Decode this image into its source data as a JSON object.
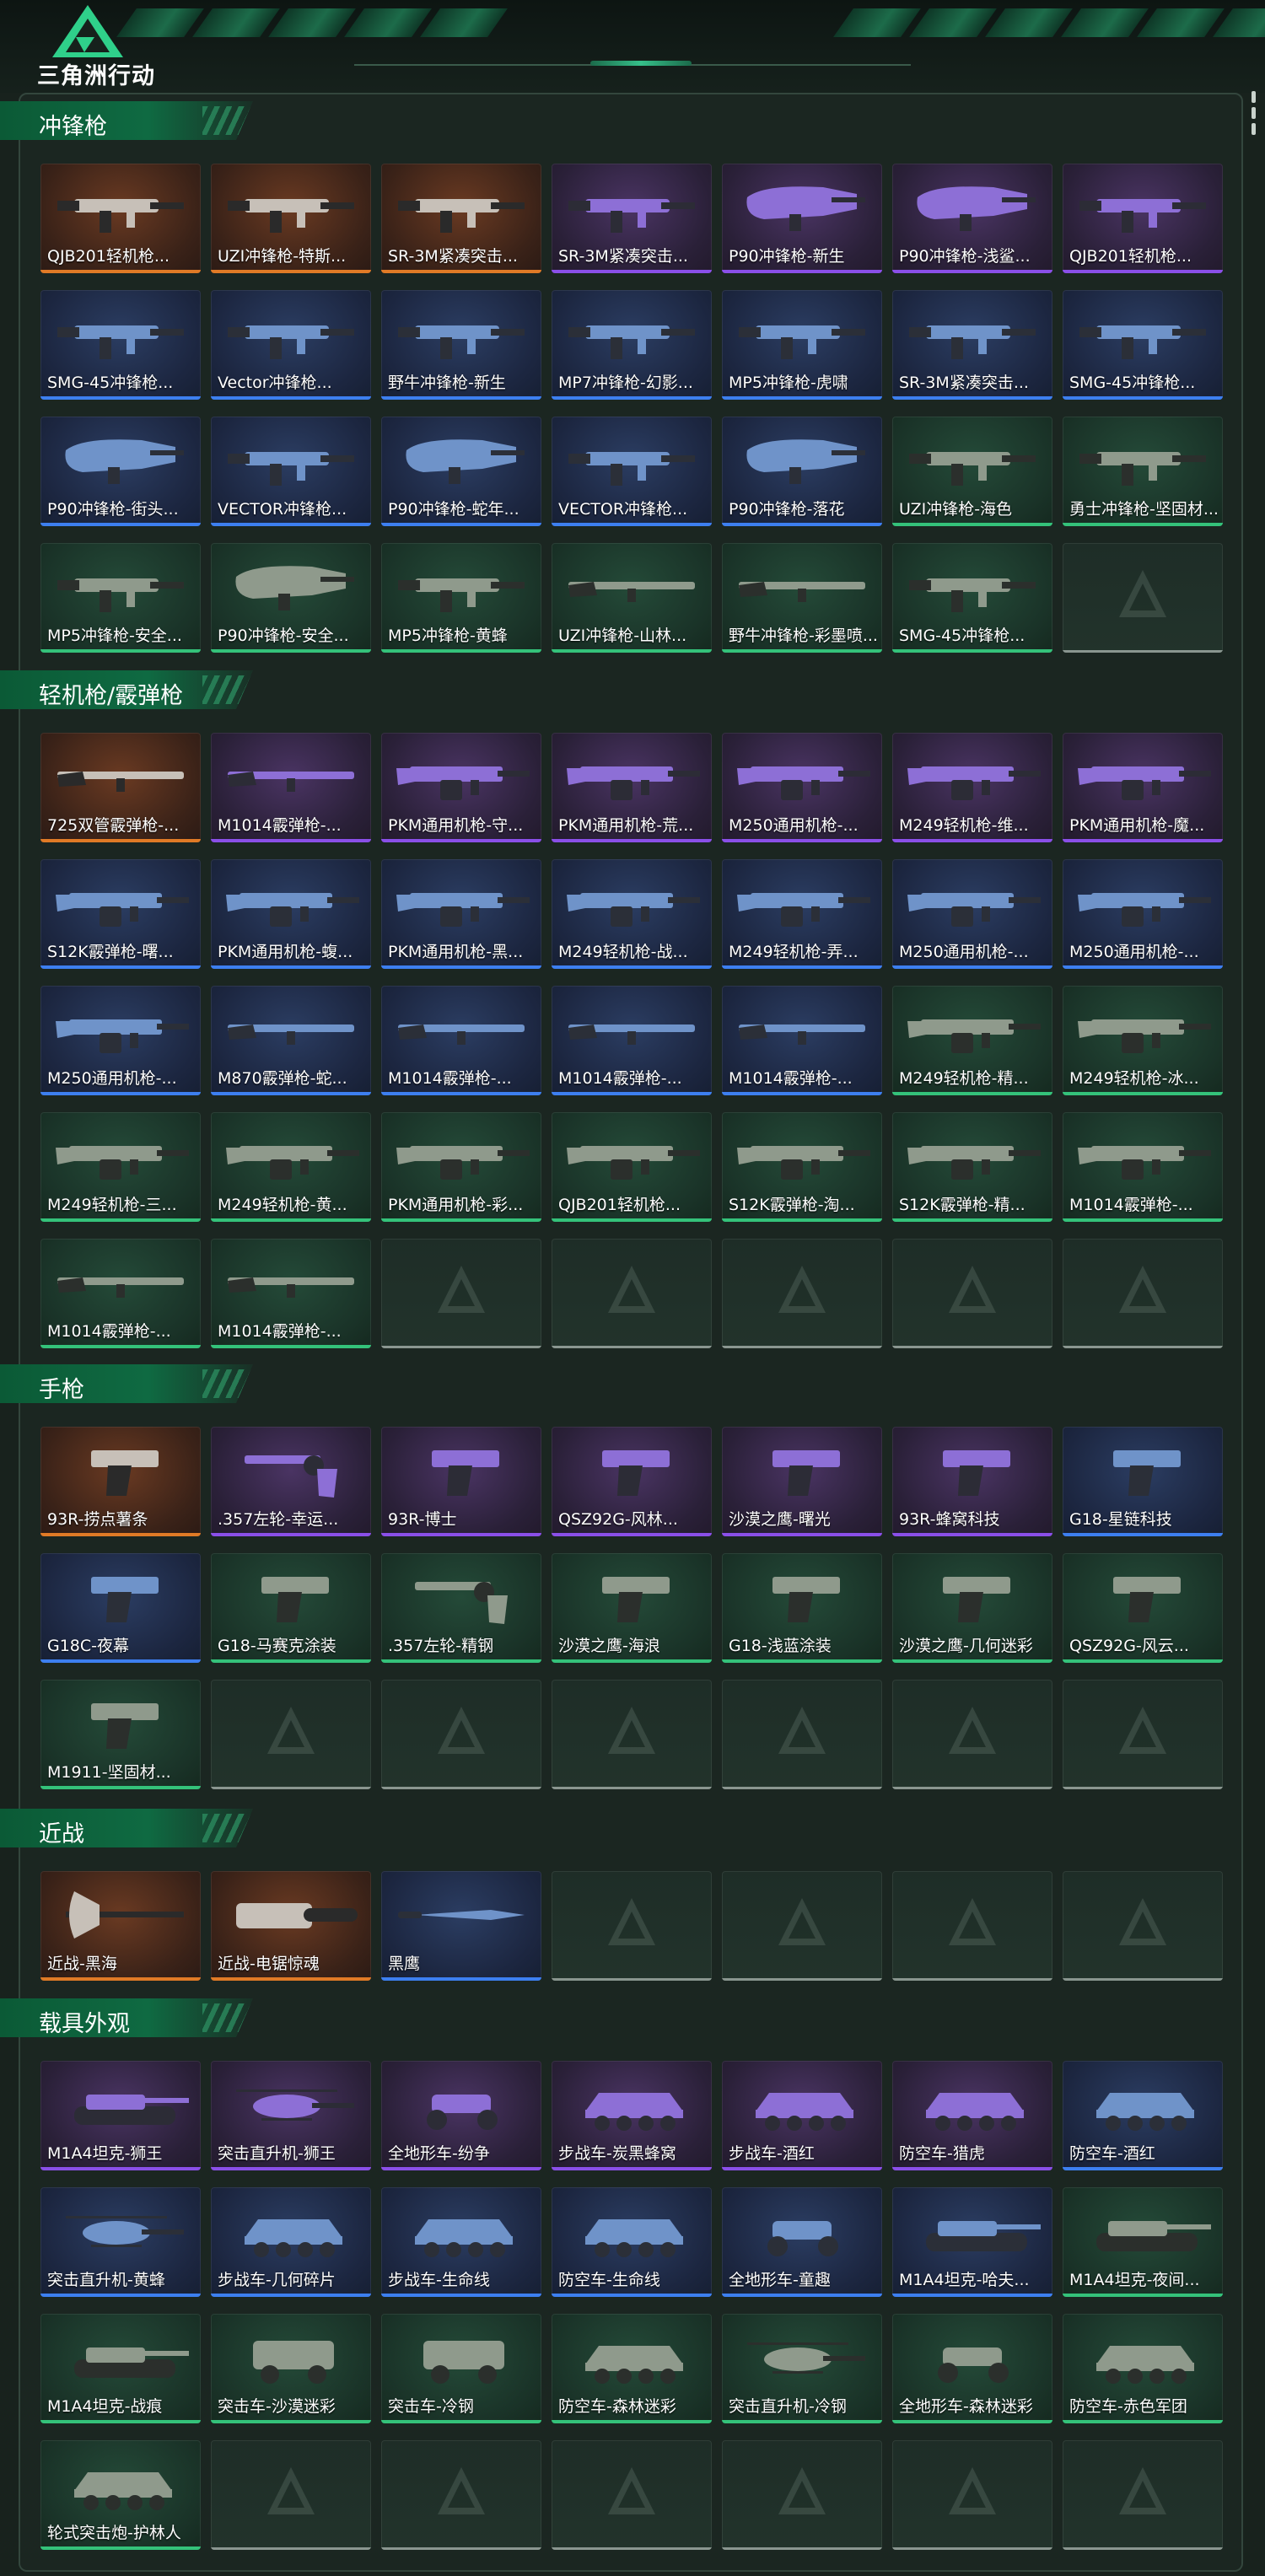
{
  "header": {
    "logo_text": "三角洲行动"
  },
  "colors": {
    "orange": "#e07a26",
    "purple": "#8a4fe8",
    "blue": "#3d7ff0",
    "green": "#34c27a"
  },
  "sections": [
    {
      "title": "冲锋枪",
      "items": [
        {
          "label": "QJB201轻机枪...",
          "rarity": "orange",
          "art": "smg"
        },
        {
          "label": "UZI冲锋枪-特斯...",
          "rarity": "orange",
          "art": "smg"
        },
        {
          "label": "SR-3M紧凑突击...",
          "rarity": "orange",
          "art": "smg"
        },
        {
          "label": "SR-3M紧凑突击...",
          "rarity": "purple",
          "art": "smg"
        },
        {
          "label": "P90冲锋枪-新生",
          "rarity": "purple",
          "art": "p90"
        },
        {
          "label": "P90冲锋枪-浅鲨...",
          "rarity": "purple",
          "art": "p90"
        },
        {
          "label": "QJB201轻机枪...",
          "rarity": "purple",
          "art": "smg"
        },
        {
          "label": "SMG-45冲锋枪...",
          "rarity": "blue",
          "art": "smg"
        },
        {
          "label": "Vector冲锋枪...",
          "rarity": "blue",
          "art": "smg"
        },
        {
          "label": "野牛冲锋枪-新生",
          "rarity": "blue",
          "art": "smg"
        },
        {
          "label": "MP7冲锋枪-幻影...",
          "rarity": "blue",
          "art": "smg"
        },
        {
          "label": "MP5冲锋枪-虎啸",
          "rarity": "blue",
          "art": "smg"
        },
        {
          "label": "SR-3M紧凑突击...",
          "rarity": "blue",
          "art": "smg"
        },
        {
          "label": "SMG-45冲锋枪...",
          "rarity": "blue",
          "art": "smg"
        },
        {
          "label": "P90冲锋枪-街头...",
          "rarity": "blue",
          "art": "p90"
        },
        {
          "label": "VECTOR冲锋枪...",
          "rarity": "blue",
          "art": "smg"
        },
        {
          "label": "P90冲锋枪-蛇年...",
          "rarity": "blue",
          "art": "p90"
        },
        {
          "label": "VECTOR冲锋枪...",
          "rarity": "blue",
          "art": "smg"
        },
        {
          "label": "P90冲锋枪-落花",
          "rarity": "blue",
          "art": "p90"
        },
        {
          "label": "UZI冲锋枪-海色",
          "rarity": "green",
          "art": "smg"
        },
        {
          "label": "勇士冲锋枪-坚固材...",
          "rarity": "green",
          "art": "smg"
        },
        {
          "label": "MP5冲锋枪-安全...",
          "rarity": "green",
          "art": "smg"
        },
        {
          "label": "P90冲锋枪-安全...",
          "rarity": "green",
          "art": "p90"
        },
        {
          "label": "MP5冲锋枪-黄蜂",
          "rarity": "green",
          "art": "smg"
        },
        {
          "label": "UZI冲锋枪-山林...",
          "rarity": "green",
          "art": "rifle"
        },
        {
          "label": "野牛冲锋枪-彩墨喷...",
          "rarity": "green",
          "art": "rifle"
        },
        {
          "label": "SMG-45冲锋枪...",
          "rarity": "green",
          "art": "smg"
        }
      ],
      "empty": 1
    },
    {
      "title": "轻机枪/霰弹枪",
      "items": [
        {
          "label": "725双管霰弹枪-...",
          "rarity": "orange",
          "art": "rifle"
        },
        {
          "label": "M1014霰弹枪-...",
          "rarity": "purple",
          "art": "rifle"
        },
        {
          "label": "PKM通用机枪-守...",
          "rarity": "purple",
          "art": "lmg"
        },
        {
          "label": "PKM通用机枪-荒...",
          "rarity": "purple",
          "art": "lmg"
        },
        {
          "label": "M250通用机枪-...",
          "rarity": "purple",
          "art": "lmg"
        },
        {
          "label": "M249轻机枪-维...",
          "rarity": "purple",
          "art": "lmg"
        },
        {
          "label": "PKM通用机枪-魔...",
          "rarity": "purple",
          "art": "lmg"
        },
        {
          "label": "S12K霰弹枪-曙...",
          "rarity": "blue",
          "art": "lmg"
        },
        {
          "label": "PKM通用机枪-蝮...",
          "rarity": "blue",
          "art": "lmg"
        },
        {
          "label": "PKM通用机枪-黑...",
          "rarity": "blue",
          "art": "lmg"
        },
        {
          "label": "M249轻机枪-战...",
          "rarity": "blue",
          "art": "lmg"
        },
        {
          "label": "M249轻机枪-弄...",
          "rarity": "blue",
          "art": "lmg"
        },
        {
          "label": "M250通用机枪-...",
          "rarity": "blue",
          "art": "lmg"
        },
        {
          "label": "M250通用机枪-...",
          "rarity": "blue",
          "art": "lmg"
        },
        {
          "label": "M250通用机枪-...",
          "rarity": "blue",
          "art": "lmg"
        },
        {
          "label": "M870霰弹枪-蛇...",
          "rarity": "blue",
          "art": "rifle"
        },
        {
          "label": "M1014霰弹枪-...",
          "rarity": "blue",
          "art": "rifle"
        },
        {
          "label": "M1014霰弹枪-...",
          "rarity": "blue",
          "art": "rifle"
        },
        {
          "label": "M1014霰弹枪-...",
          "rarity": "blue",
          "art": "rifle"
        },
        {
          "label": "M249轻机枪-精...",
          "rarity": "green",
          "art": "lmg"
        },
        {
          "label": "M249轻机枪-冰...",
          "rarity": "green",
          "art": "lmg"
        },
        {
          "label": "M249轻机枪-三...",
          "rarity": "green",
          "art": "lmg"
        },
        {
          "label": "M249轻机枪-黄...",
          "rarity": "green",
          "art": "lmg"
        },
        {
          "label": "PKM通用机枪-彩...",
          "rarity": "green",
          "art": "lmg"
        },
        {
          "label": "QJB201轻机枪...",
          "rarity": "green",
          "art": "lmg"
        },
        {
          "label": "S12K霰弹枪-淘...",
          "rarity": "green",
          "art": "lmg"
        },
        {
          "label": "S12K霰弹枪-精...",
          "rarity": "green",
          "art": "lmg"
        },
        {
          "label": "M1014霰弹枪-...",
          "rarity": "green",
          "art": "lmg"
        },
        {
          "label": "M1014霰弹枪-...",
          "rarity": "green",
          "art": "rifle"
        },
        {
          "label": "M1014霰弹枪-...",
          "rarity": "green",
          "art": "rifle"
        }
      ],
      "empty": 5
    },
    {
      "title": "手枪",
      "items": [
        {
          "label": "93R-捞点薯条",
          "rarity": "orange",
          "art": "pistol"
        },
        {
          "label": ".357左轮-幸运...",
          "rarity": "purple",
          "art": "revolver"
        },
        {
          "label": "93R-博士",
          "rarity": "purple",
          "art": "pistol"
        },
        {
          "label": "QSZ92G-风林...",
          "rarity": "purple",
          "art": "pistol"
        },
        {
          "label": "沙漠之鹰-曙光",
          "rarity": "purple",
          "art": "pistol"
        },
        {
          "label": "93R-蜂窝科技",
          "rarity": "purple",
          "art": "pistol"
        },
        {
          "label": "G18-星链科技",
          "rarity": "blue",
          "art": "pistol"
        },
        {
          "label": "G18C-夜幕",
          "rarity": "blue",
          "art": "pistol"
        },
        {
          "label": "G18-马赛克涂装",
          "rarity": "green",
          "art": "pistol"
        },
        {
          "label": ".357左轮-精钢",
          "rarity": "green",
          "art": "revolver"
        },
        {
          "label": "沙漠之鹰-海浪",
          "rarity": "green",
          "art": "pistol"
        },
        {
          "label": "G18-浅蓝涂装",
          "rarity": "green",
          "art": "pistol"
        },
        {
          "label": "沙漠之鹰-几何迷彩",
          "rarity": "green",
          "art": "pistol"
        },
        {
          "label": "QSZ92G-风云...",
          "rarity": "green",
          "art": "pistol"
        },
        {
          "label": "M1911-坚固材...",
          "rarity": "green",
          "art": "pistol"
        }
      ],
      "empty": 6
    },
    {
      "title": "近战",
      "items": [
        {
          "label": "近战-黑海",
          "rarity": "orange",
          "art": "axe"
        },
        {
          "label": "近战-电锯惊魂",
          "rarity": "orange",
          "art": "chainsaw"
        },
        {
          "label": "黑鹰",
          "rarity": "blue",
          "art": "knife"
        }
      ],
      "empty": 4
    },
    {
      "title": "载具外观",
      "items": [
        {
          "label": "M1A4坦克-狮王",
          "rarity": "purple",
          "art": "tank"
        },
        {
          "label": "突击直升机-狮王",
          "rarity": "purple",
          "art": "heli"
        },
        {
          "label": "全地形车-纷争",
          "rarity": "purple",
          "art": "atv"
        },
        {
          "label": "步战车-炭黑蜂窝",
          "rarity": "purple",
          "art": "apc"
        },
        {
          "label": "步战车-酒红",
          "rarity": "purple",
          "art": "apc"
        },
        {
          "label": "防空车-猎虎",
          "rarity": "purple",
          "art": "apc"
        },
        {
          "label": "防空车-酒红",
          "rarity": "blue",
          "art": "apc"
        },
        {
          "label": "突击直升机-黄蜂",
          "rarity": "blue",
          "art": "heli"
        },
        {
          "label": "步战车-几何碎片",
          "rarity": "blue",
          "art": "apc"
        },
        {
          "label": "步战车-生命线",
          "rarity": "blue",
          "art": "apc"
        },
        {
          "label": "防空车-生命线",
          "rarity": "blue",
          "art": "apc"
        },
        {
          "label": "全地形车-童趣",
          "rarity": "blue",
          "art": "atv"
        },
        {
          "label": "M1A4坦克-哈夫...",
          "rarity": "blue",
          "art": "tank"
        },
        {
          "label": "M1A4坦克-夜间...",
          "rarity": "green",
          "art": "tank"
        },
        {
          "label": "M1A4坦克-战痕",
          "rarity": "green",
          "art": "tank"
        },
        {
          "label": "突击车-沙漠迷彩",
          "rarity": "green",
          "art": "truck"
        },
        {
          "label": "突击车-冷钢",
          "rarity": "green",
          "art": "truck"
        },
        {
          "label": "防空车-森林迷彩",
          "rarity": "green",
          "art": "apc"
        },
        {
          "label": "突击直升机-冷钢",
          "rarity": "green",
          "art": "heli"
        },
        {
          "label": "全地形车-森林迷彩",
          "rarity": "green",
          "art": "atv"
        },
        {
          "label": "防空车-赤色军团",
          "rarity": "green",
          "art": "apc"
        },
        {
          "label": "轮式突击炮-护林人",
          "rarity": "green",
          "art": "apc"
        }
      ],
      "empty": 6
    }
  ]
}
